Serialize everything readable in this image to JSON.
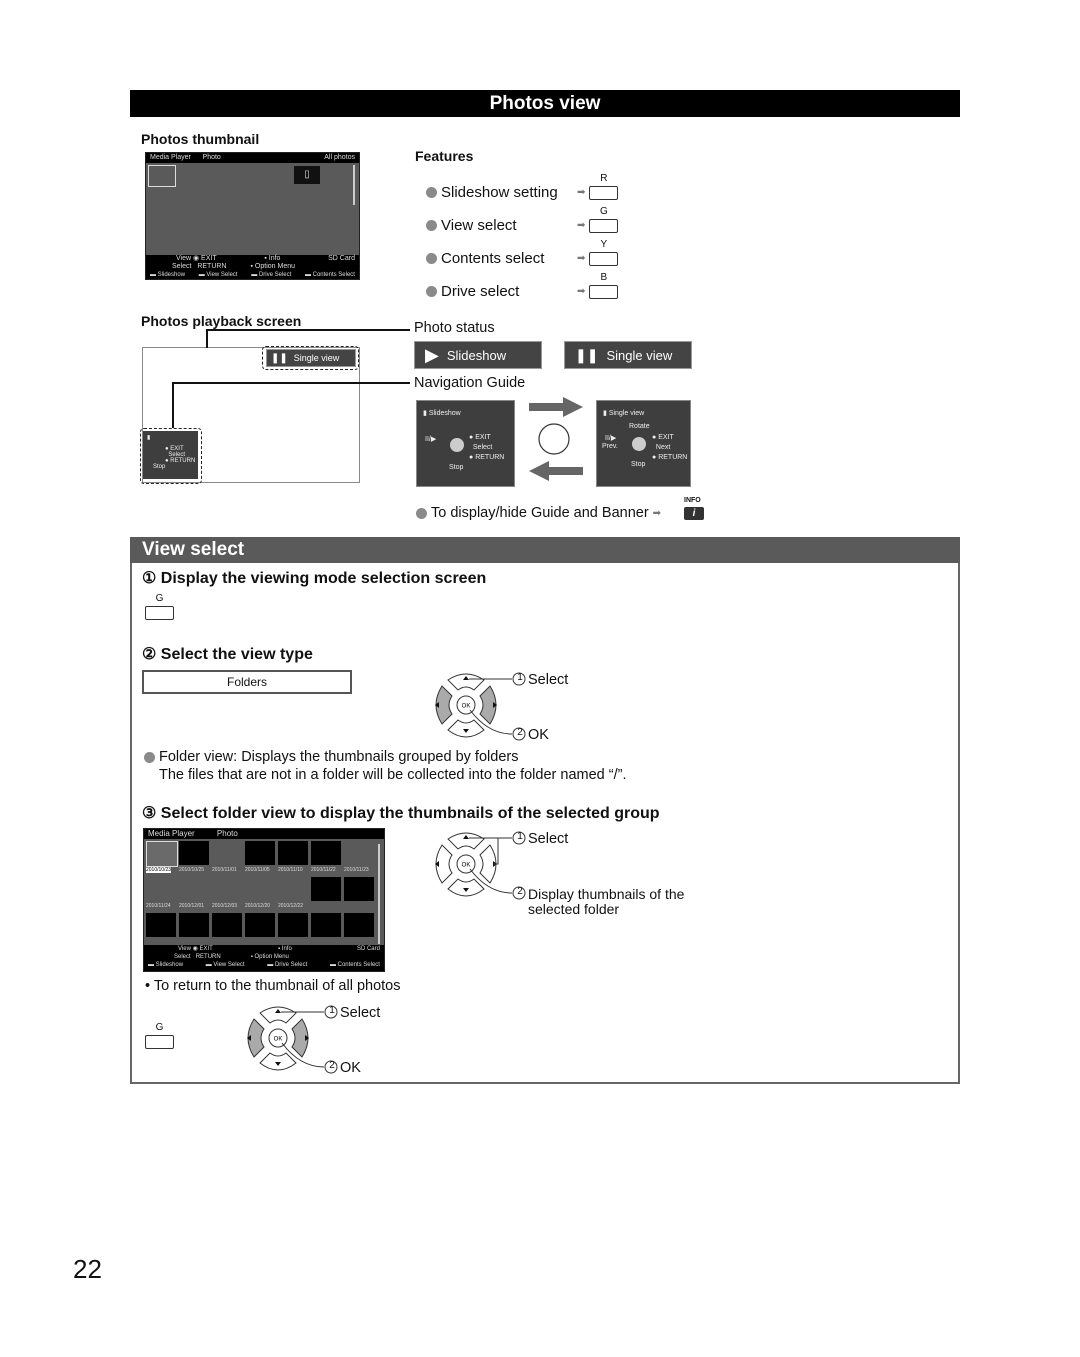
{
  "banner": {
    "title": "Photos view"
  },
  "thumbnail_section": {
    "heading": "Photos thumbnail",
    "screen": {
      "top_left": "Media Player",
      "top_mid": "Photo",
      "top_right": "All photos",
      "bottom_row1": [
        "View",
        "EXIT",
        "Info",
        "SD Card"
      ],
      "bottom_row2": [
        "Select",
        "RETURN",
        "Option Menu"
      ],
      "bottom_row3": [
        "Slideshow",
        "View Select",
        "Drive Select",
        "Contents Select"
      ]
    }
  },
  "features": {
    "heading": "Features",
    "items": [
      {
        "label": "Slideshow setting",
        "button": "R"
      },
      {
        "label": "View select",
        "button": "G"
      },
      {
        "label": "Contents select",
        "button": "Y"
      },
      {
        "label": "Drive select",
        "button": "B"
      }
    ]
  },
  "playback_section": {
    "heading": "Photos playback screen",
    "status_badge": "Single view",
    "guide": {
      "stop": "Stop",
      "exit": "EXIT",
      "select": "Select",
      "return": "RETURN"
    }
  },
  "photo_status": {
    "label": "Photo status",
    "slideshow": "Slideshow",
    "single_view": "Single view"
  },
  "navigation_guide": {
    "label": "Navigation Guide",
    "slideshow_box": {
      "title": "Slideshow",
      "play": "II/▶",
      "exit": "EXIT",
      "select": "Select",
      "return": "RETURN",
      "stop": "Stop"
    },
    "single_box": {
      "title": "Single view",
      "rotate": "Rotate",
      "play": "II/▶",
      "prev": "Prev.",
      "exit": "EXIT",
      "next": "Next",
      "return": "RETURN",
      "stop": "Stop"
    },
    "toggle_note": "To display/hide Guide and Banner",
    "info_label": "INFO"
  },
  "view_select": {
    "heading": "View select",
    "step1": {
      "num": "①",
      "title": "Display the viewing mode selection screen",
      "button": "G"
    },
    "step2": {
      "num": "②",
      "title": "Select the view type",
      "option": "Folders",
      "select_label": "Select",
      "ok_label": "OK",
      "n1": "1",
      "n2": "2"
    },
    "note_line1": "Folder view: Displays the thumbnails grouped by folders",
    "note_line2": "The files that are not in a folder will be collected into the folder named “/”.",
    "step3": {
      "num": "③",
      "title": "Select folder view to display the thumbnails of the selected group",
      "select_label": "Select",
      "display_label_1": "Display thumbnails of the",
      "display_label_2": "selected folder",
      "n1": "1",
      "n2": "2",
      "screen": {
        "top_left": "Media Player",
        "top_mid": "Photo",
        "dates_row1": [
          "2010/10/23",
          "2010/10/25",
          "2010/11/01",
          "2010/11/05",
          "2010/11/10",
          "2010/11/22",
          "2010/11/23"
        ],
        "dates_row2": [
          "2010/11/24",
          "2010/12/01",
          "2010/12/03",
          "2010/12/20",
          "2010/12/22"
        ],
        "bottom_row1": [
          "View",
          "EXIT",
          "Info",
          "SD Card"
        ],
        "bottom_row2": [
          "Select",
          "RETURN",
          "Option Menu"
        ],
        "bottom_row3": [
          "Slideshow",
          "View Select",
          "Drive Select",
          "Contents Select"
        ]
      }
    },
    "return_note": "To return to the thumbnail of all photos",
    "return_button": "G",
    "return_select": "Select",
    "return_ok": "OK",
    "n1": "1",
    "n2": "2"
  },
  "page_number": "22"
}
